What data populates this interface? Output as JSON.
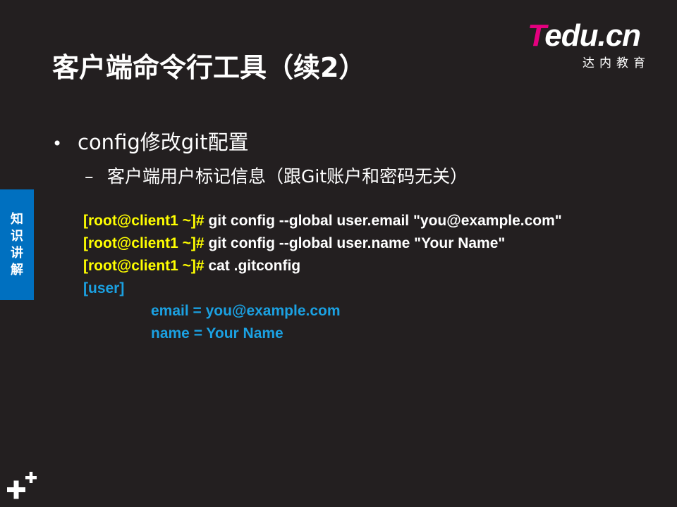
{
  "title": "客户端命令行工具（续2）",
  "logo": {
    "word_t": "T",
    "word_rest": "edu.cn",
    "subtitle": "达内教育",
    "brand_color": "#e4007f"
  },
  "side_tab": {
    "label": "知识讲解",
    "color": "#0070c0"
  },
  "bullets": {
    "level1": {
      "marker": "•",
      "text": "config修改git配置"
    },
    "level2": {
      "marker": "–",
      "text": "客户端用户标记信息（跟Git账户和密码无关）"
    }
  },
  "code": {
    "prompt_color": "#ffff00",
    "output_color": "#1ba1e2",
    "lines": [
      {
        "prompt": "[root@client1 ~]# ",
        "command": "git config --global user.email \"you@example.com\""
      },
      {
        "prompt": "[root@client1 ~]# ",
        "command": "git config --global user.name \"Your Name\""
      },
      {
        "prompt": "[root@client1 ~]# ",
        "command": "cat .gitconfig"
      }
    ],
    "output": [
      "[user]",
      "email = you@example.com",
      "name = Your Name"
    ]
  },
  "corner_icon": "plus-plus-icon"
}
